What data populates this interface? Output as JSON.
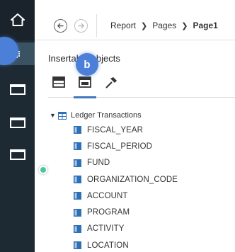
{
  "breadcrumb": {
    "items": [
      "Report",
      "Pages",
      "Page1"
    ]
  },
  "panel": {
    "title": "Insertable objects"
  },
  "badges": {
    "b": "b"
  },
  "tree": {
    "root": "Ledger Transactions",
    "items": [
      "FISCAL_YEAR",
      "FISCAL_PERIOD",
      "FUND",
      "ORGANIZATION_CODE",
      "ACCOUNT",
      "PROGRAM",
      "ACTIVITY",
      "LOCATION"
    ]
  },
  "colors": {
    "rail": "#1e2a33",
    "accent": "#4178be",
    "badge": "#4c7fd8",
    "drag_handle": "#45c89b",
    "field_icon": "#2f6fb5"
  },
  "icons": {
    "home": "home-icon",
    "insertable": "insertable-objects-icon",
    "folder": "folder-icon",
    "back": "back-arrow-icon",
    "forward": "forward-arrow-icon",
    "tab1": "source-icon",
    "tab2": "data-items-icon",
    "tab3": "toolbox-icon"
  }
}
